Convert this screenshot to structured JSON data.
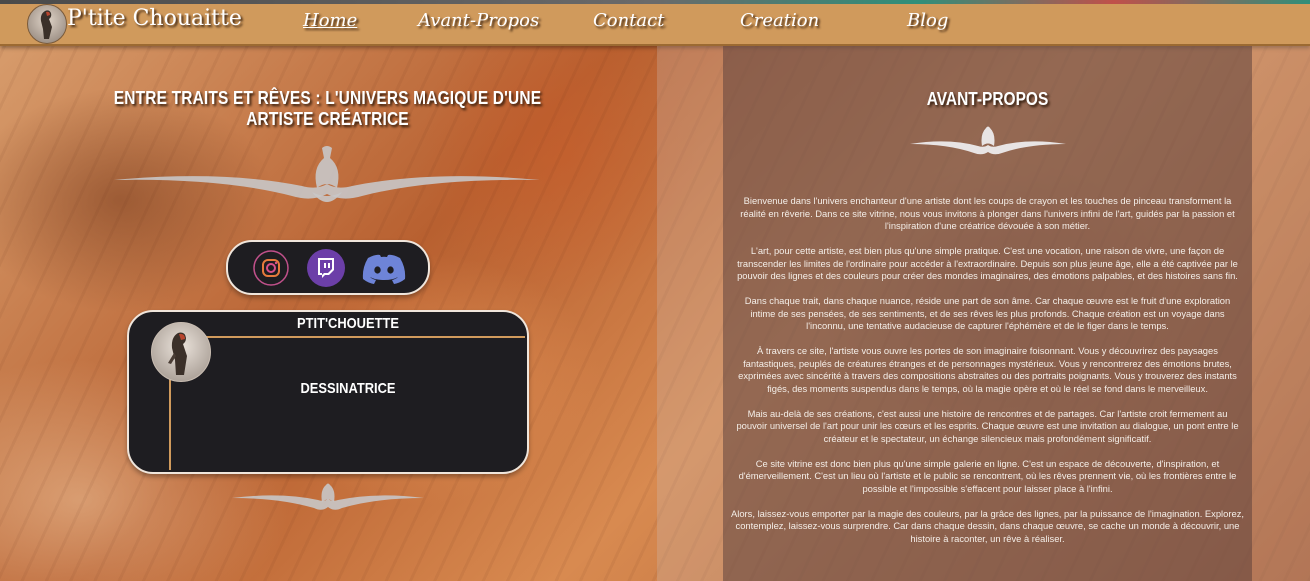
{
  "header": {
    "site_title": "P'tite Chouaitte",
    "nav": [
      {
        "label": "Home",
        "active": true
      },
      {
        "label": "Avant-Propos",
        "active": false
      },
      {
        "label": "Contact",
        "active": false
      },
      {
        "label": "Creation",
        "active": false
      },
      {
        "label": "Blog",
        "active": false
      }
    ]
  },
  "left": {
    "title": "Entre traits et rêves : l'univers magique d'une artiste créatrice",
    "social": [
      "instagram-icon",
      "twitch-icon",
      "discord-icon"
    ],
    "profile": {
      "name": "PTIT'CHOUETTE",
      "role": "DESSINATRICE"
    }
  },
  "right": {
    "title": "AVANT-PROPOS",
    "paragraphs": [
      "Bienvenue dans l'univers enchanteur d'une artiste dont les coups de crayon et les touches de pinceau transforment la réalité en rêverie. Dans ce site vitrine, nous vous invitons à plonger dans l'univers infini de l'art, guidés par la passion et l'inspiration d'une créatrice dévouée à son métier.",
      "L'art, pour cette artiste, est bien plus qu'une simple pratique. C'est une vocation, une raison de vivre, une façon de transcender les limites de l'ordinaire pour accéder à l'extraordinaire. Depuis son plus jeune âge, elle a été captivée par le pouvoir des lignes et des couleurs pour créer des mondes imaginaires, des émotions palpables, et des histoires sans fin.",
      "Dans chaque trait, dans chaque nuance, réside une part de son âme. Car chaque œuvre est le fruit d'une exploration intime de ses pensées, de ses sentiments, et de ses rêves les plus profonds. Chaque création est un voyage dans l'inconnu, une tentative audacieuse de capturer l'éphémère et de le figer dans le temps.",
      "À travers ce site, l'artiste vous ouvre les portes de son imaginaire foisonnant. Vous y découvrirez des paysages fantastiques, peuplés de créatures étranges et de personnages mystérieux. Vous y rencontrerez des émotions brutes, exprimées avec sincérité à travers des compositions abstraites ou des portraits poignants. Vous y trouverez des instants figés, des moments suspendus dans le temps, où la magie opère et où le réel se fond dans le merveilleux.",
      "Mais au-delà de ses créations, c'est aussi une histoire de rencontres et de partages. Car l'artiste croit fermement au pouvoir universel de l'art pour unir les cœurs et les esprits. Chaque œuvre est une invitation au dialogue, un pont entre le créateur et le spectateur, un échange silencieux mais profondément significatif.",
      "Ce site vitrine est donc bien plus qu'une simple galerie en ligne. C'est un espace de découverte, d'inspiration, et d'émerveillement. C'est un lieu où l'artiste et le public se rencontrent, où les rêves prennent vie, où les frontières entre le possible et l'impossible s'effacent pour laisser place à l'infini.",
      "Alors, laissez-vous emporter par la magie des couleurs, par la grâce des lignes, par la puissance de l'imagination. Explorez, contemplez, laissez-vous surprendre. Car dans chaque dessin, dans chaque œuvre, se cache un monde à découvrir, une histoire à raconter, un rêve à réaliser."
    ]
  },
  "colors": {
    "header": "#d09a5c",
    "card": "#1e1d21",
    "accent": "#d09a5c"
  }
}
